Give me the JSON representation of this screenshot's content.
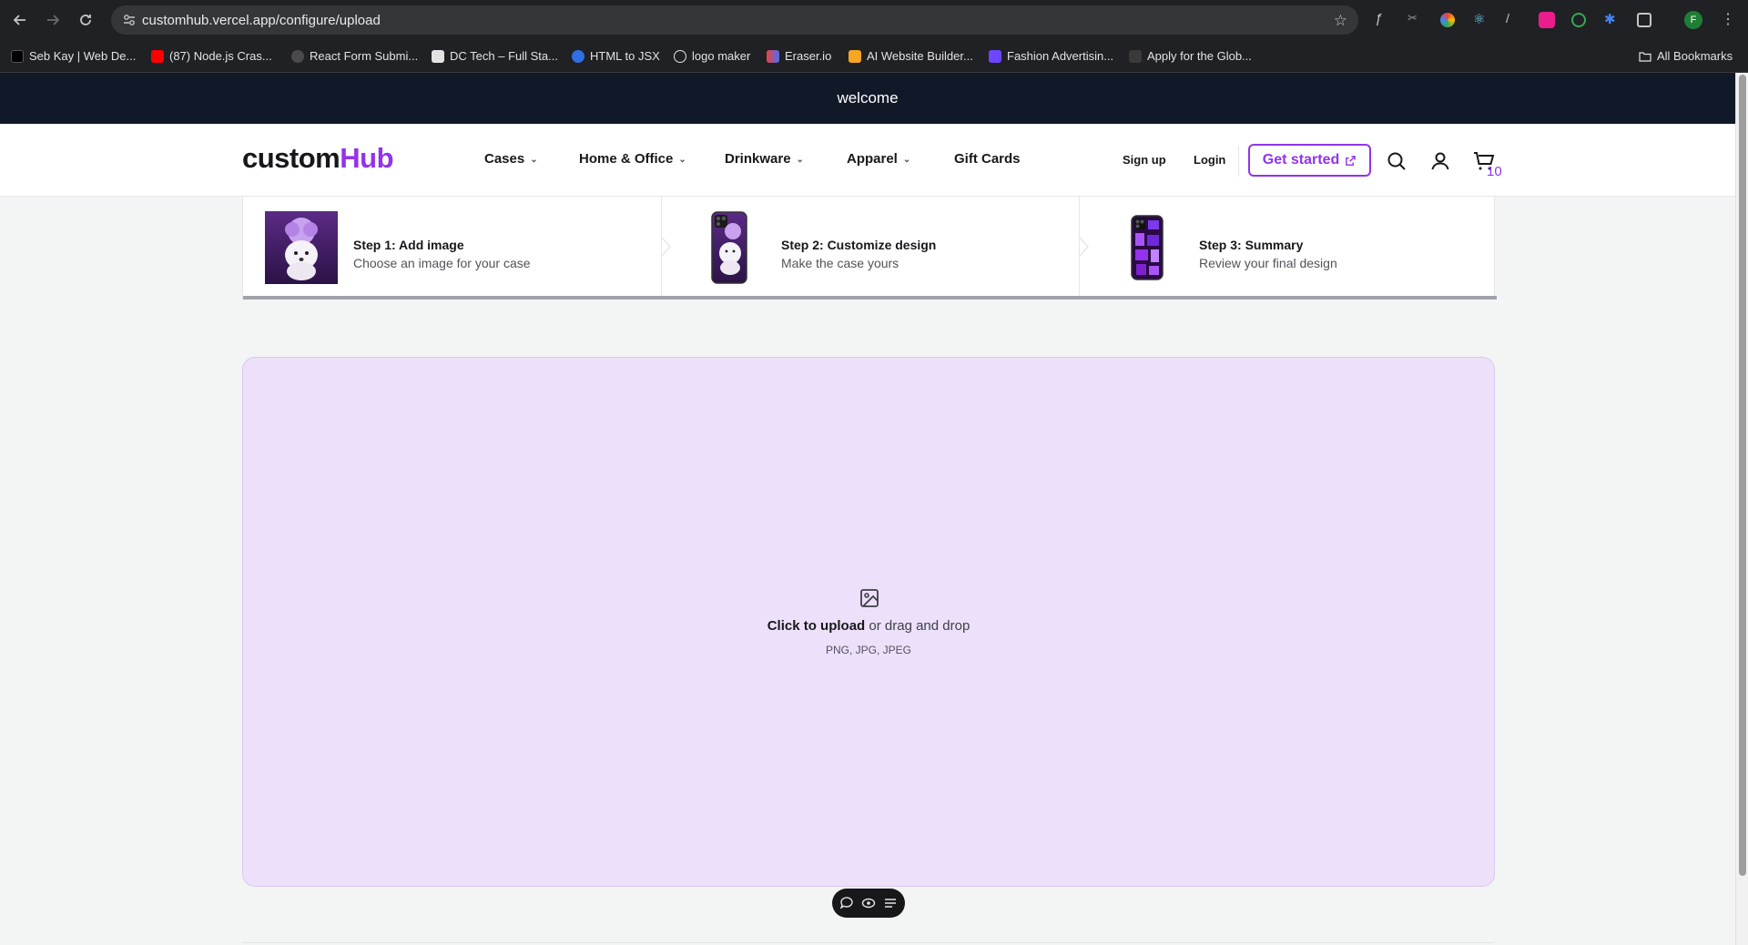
{
  "browser": {
    "url": "customhub.vercel.app/configure/upload",
    "bookmarks": [
      {
        "label": "Seb Kay | Web De...",
        "color": "#000000"
      },
      {
        "label": "(87) Node.js Cras...",
        "color": "#ff0000"
      },
      {
        "label": "React Form Submi...",
        "color": "#4a4a4a"
      },
      {
        "label": "DC Tech – Full Sta...",
        "color": "#1f1f1f"
      },
      {
        "label": "HTML to JSX",
        "color": "#2f6fe4"
      },
      {
        "label": "logo maker",
        "color": "#2a2a2a"
      },
      {
        "label": "Eraser.io",
        "color": "#e8453c"
      },
      {
        "label": "AI Website Builder...",
        "color": "#f5a623"
      },
      {
        "label": "Fashion Advertisin...",
        "color": "#6c47ff"
      },
      {
        "label": "Apply for the Glob...",
        "color": "#3a3a3a"
      }
    ],
    "all_bookmarks": "All Bookmarks",
    "profile_initial": "F"
  },
  "banner": {
    "text": "welcome"
  },
  "header": {
    "logo_part1": "custom",
    "logo_part2": "Hub",
    "nav": [
      "Cases",
      "Home & Office",
      "Drinkware",
      "Apparel",
      "Gift Cards"
    ],
    "sign_up": "Sign up",
    "login": "Login",
    "get_started": "Get started",
    "cart_count": "10",
    "accent": "#9333ea"
  },
  "steps": [
    {
      "title": "Step 1: Add image",
      "subtitle": "Choose an image for your case"
    },
    {
      "title": "Step 2: Customize design",
      "subtitle": "Make the case yours"
    },
    {
      "title": "Step 3: Summary",
      "subtitle": "Review your final design"
    }
  ],
  "upload": {
    "click_text": "Click to upload",
    "rest_text": " or drag and drop",
    "types": "PNG, JPG, JPEG"
  }
}
